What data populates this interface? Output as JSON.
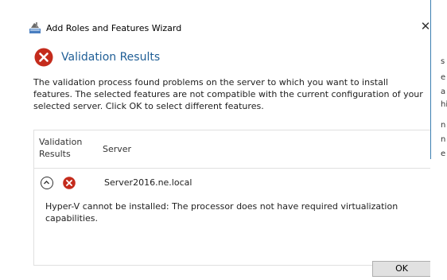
{
  "window": {
    "title": "Add Roles and Features Wizard",
    "close_glyph": "✕"
  },
  "header": {
    "title": "Validation Results",
    "icon": "error-icon"
  },
  "description": "The validation process found problems on the server to which you want to install features. The selected features are not compatible with the current configuration of your selected server.  Click OK to select different features.",
  "table": {
    "columns": {
      "validation_results": "Validation Results",
      "server": "Server"
    },
    "rows": [
      {
        "server": "Server2016.ne.local",
        "status_icon": "error-icon",
        "message": "Hyper-V cannot be installed: The processor does not have required virtualization capabilities."
      }
    ]
  },
  "buttons": {
    "ok_label": "OK"
  },
  "background_window": {
    "chars": [
      "s",
      "e",
      "a",
      "hi",
      "n",
      "n",
      "e"
    ]
  },
  "colors": {
    "title_blue": "#1f5e96",
    "error_red": "#c42b1c",
    "accent": "#3c7fb1"
  }
}
